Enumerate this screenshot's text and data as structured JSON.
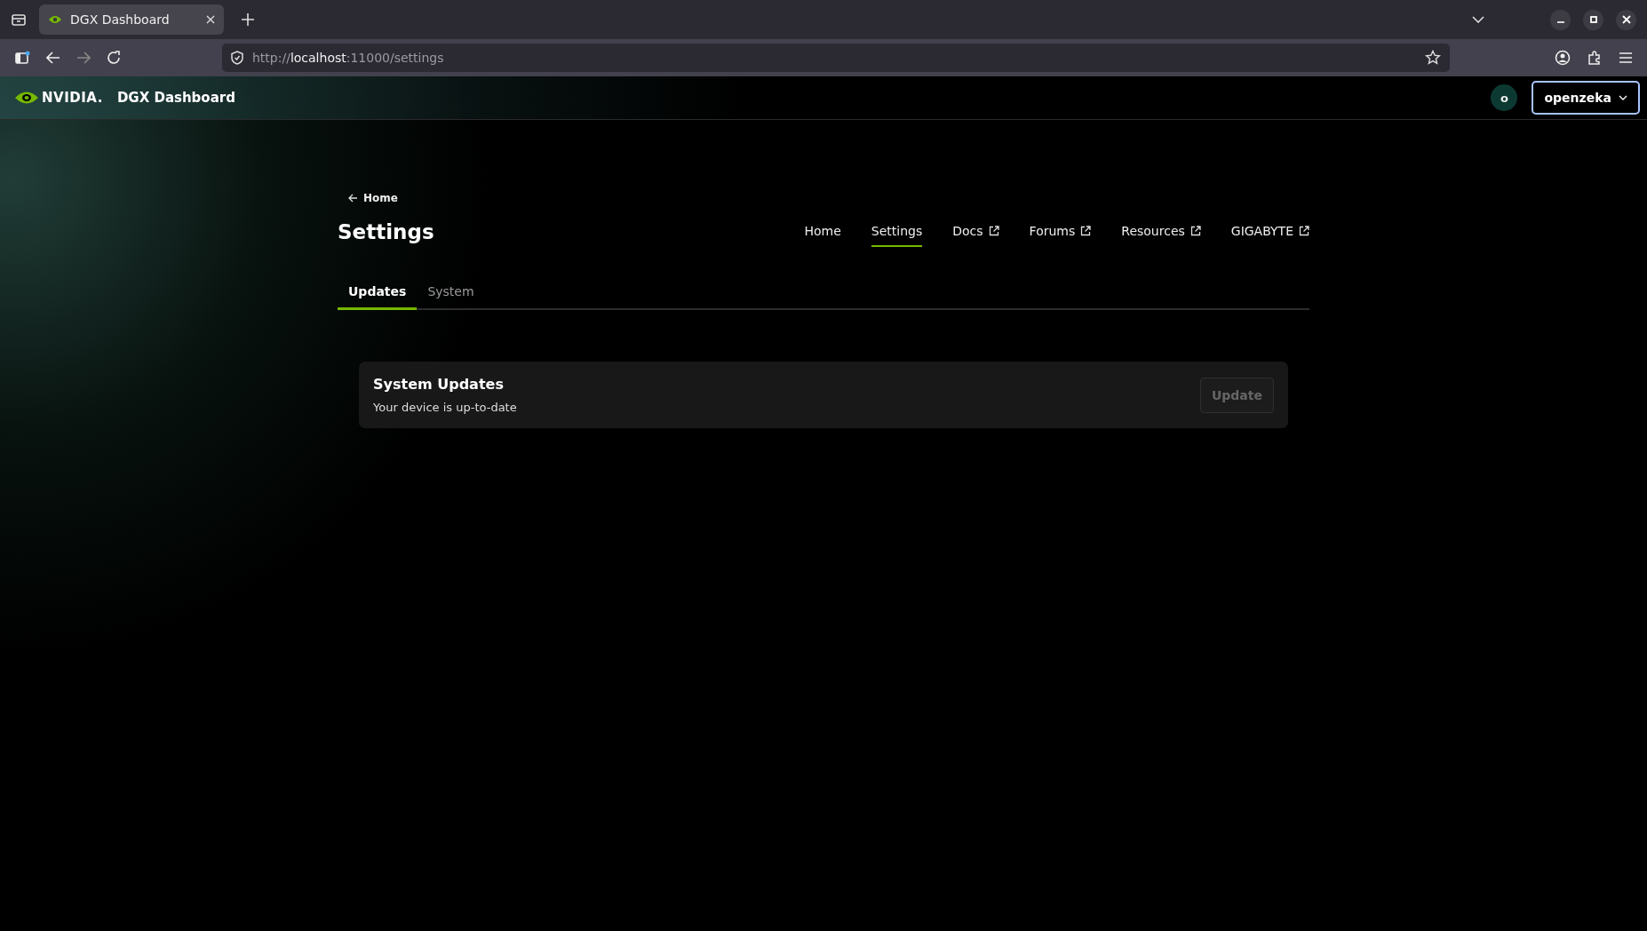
{
  "browser": {
    "tab_title": "DGX Dashboard",
    "url": {
      "prefix": "http://",
      "host": "localhost",
      "suffix": ":11000/settings"
    }
  },
  "header": {
    "brand": "NVIDIA.",
    "title": "DGX Dashboard",
    "avatar": "o",
    "user": "openzeka"
  },
  "back_link": "Home",
  "page_title": "Settings",
  "nav": [
    {
      "label": "Home",
      "selected": false,
      "external": false
    },
    {
      "label": "Settings",
      "selected": true,
      "external": false
    },
    {
      "label": "Docs",
      "selected": false,
      "external": true
    },
    {
      "label": "Forums",
      "selected": false,
      "external": true
    },
    {
      "label": "Resources",
      "selected": false,
      "external": true
    },
    {
      "label": "GIGABYTE",
      "selected": false,
      "external": true
    }
  ],
  "tabs": [
    {
      "label": "Updates",
      "selected": true
    },
    {
      "label": "System",
      "selected": false
    }
  ],
  "card": {
    "title": "System Updates",
    "description": "Your device is up-to-date",
    "button": {
      "label": "Update",
      "disabled": true
    }
  }
}
